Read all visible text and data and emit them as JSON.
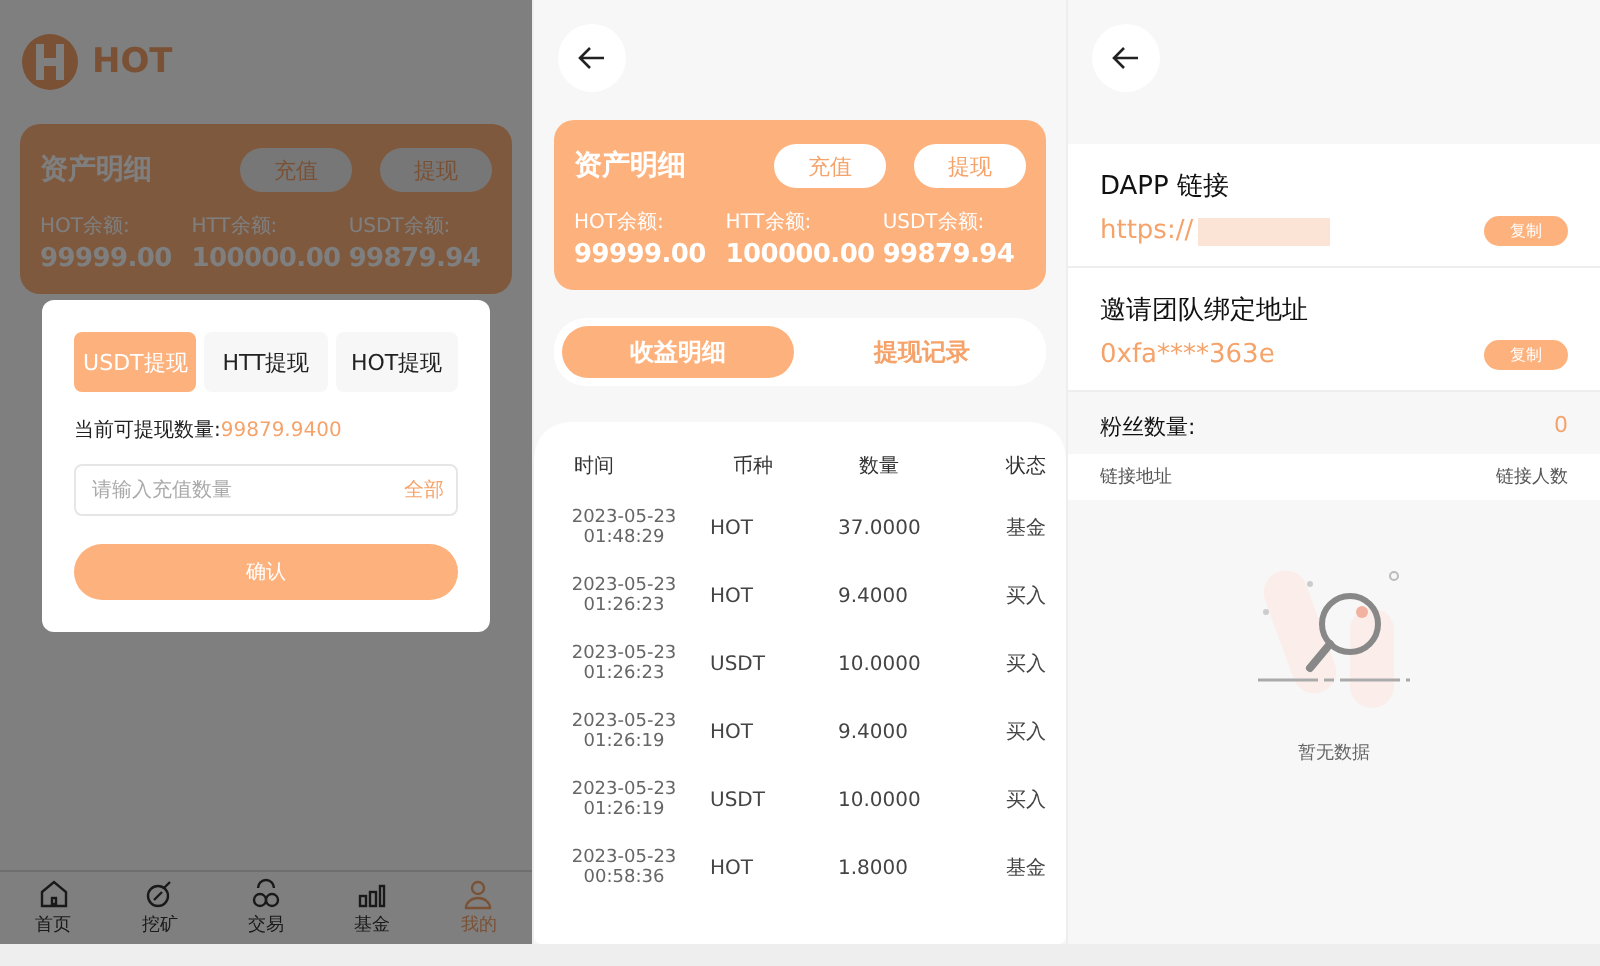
{
  "wallet_screen": {
    "logo": {
      "text": "HOT"
    },
    "asset_card": {
      "title": "资产明细",
      "buttons": [
        "充值",
        "提现"
      ],
      "balances": [
        {
          "label": "HOT余额:",
          "value": "99999.00"
        },
        {
          "label": "HTT余额:",
          "value": "100000.00"
        },
        {
          "label": "USDT余额:",
          "value": "99879.94"
        }
      ]
    },
    "modal": {
      "tabs": [
        {
          "label": "USDT提现",
          "selected": true
        },
        {
          "label": "HTT提现",
          "selected": false
        },
        {
          "label": "HOT提现",
          "selected": false
        }
      ],
      "available_label": "当前可提现数量:",
      "available_value": "99879.9400",
      "amount_field": {
        "placeholder": "请输入充值数量"
      },
      "all_link": "全部",
      "confirm_button": "确认"
    },
    "nav": [
      {
        "label": "首页",
        "selected": false
      },
      {
        "label": "挖矿",
        "selected": false
      },
      {
        "label": "交易",
        "selected": false
      },
      {
        "label": "基金",
        "selected": false
      },
      {
        "label": "我的",
        "selected": true
      }
    ]
  },
  "records_screen": {
    "asset_card": {
      "title": "资产明细",
      "buttons": [
        "充值",
        "提现"
      ],
      "balances": [
        {
          "label": "HOT余额:",
          "value": "99999.00"
        },
        {
          "label": "HTT余额:",
          "value": "100000.00"
        },
        {
          "label": "USDT余额:",
          "value": "99879.94"
        }
      ]
    },
    "tabs": [
      {
        "label": "收益明细",
        "selected": true
      },
      {
        "label": "提现记录",
        "selected": false
      }
    ],
    "table": {
      "columns": [
        "时间",
        "币种",
        "数量",
        "状态"
      ],
      "rows": [
        [
          "2023-05-23 01:48:29",
          "HOT",
          "37.0000",
          "基金"
        ],
        [
          "2023-05-23 01:26:23",
          "HOT",
          "9.4000",
          "买入"
        ],
        [
          "2023-05-23 01:26:23",
          "USDT",
          "10.0000",
          "买入"
        ],
        [
          "2023-05-23 01:26:19",
          "HOT",
          "9.4000",
          "买入"
        ],
        [
          "2023-05-23 01:26:19",
          "USDT",
          "10.0000",
          "买入"
        ],
        [
          "2023-05-23 00:58:36",
          "HOT",
          "1.8000",
          "基金"
        ]
      ]
    }
  },
  "invite_screen": {
    "links": [
      {
        "title": "DAPP 链接",
        "value": "https://",
        "redacted": true,
        "copy_button": "复制"
      },
      {
        "title": "邀请团队绑定地址",
        "value": "0xfa****363e",
        "redacted": false,
        "copy_button": "复制"
      }
    ],
    "fans": {
      "label": "粉丝数量:",
      "value": "0"
    },
    "table": {
      "columns": [
        "链接地址",
        "链接人数"
      ]
    },
    "empty_text": "暂无数据"
  }
}
